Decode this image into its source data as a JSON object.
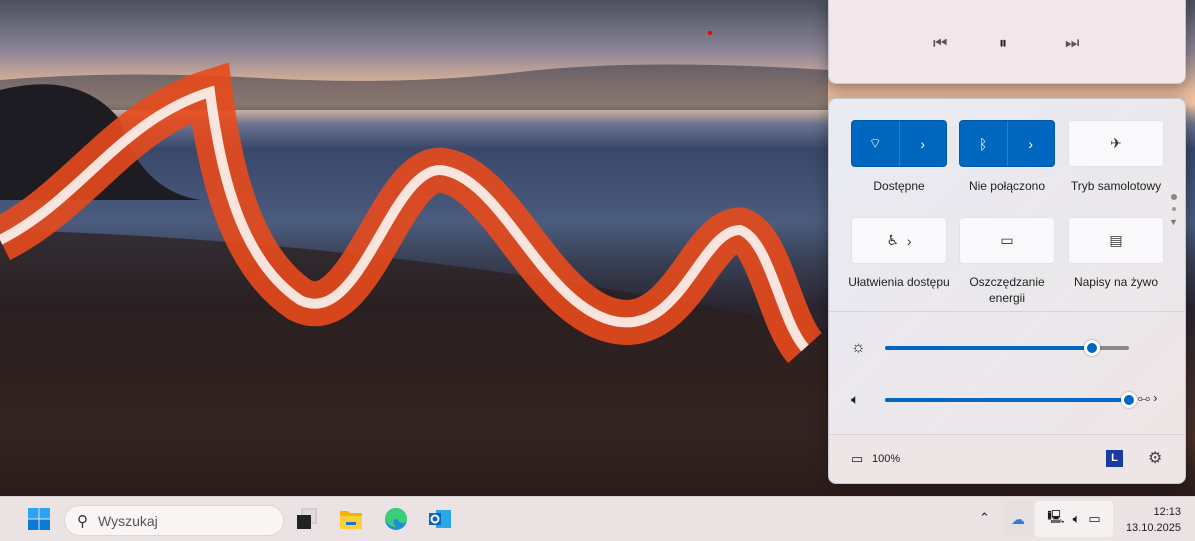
{
  "media": {
    "prev_icon": "previous-track-icon",
    "play_pause_icon": "pause-icon",
    "next_icon": "next-track-icon"
  },
  "quick_settings": {
    "tiles": [
      {
        "label": "Dostępne",
        "icon": "wifi-icon",
        "active": true
      },
      {
        "label": "Nie połączono",
        "icon": "bluetooth-icon",
        "active": true
      },
      {
        "label": "Tryb samolotowy",
        "icon": "airplane-icon",
        "active": false
      },
      {
        "label": "Ułatwienia dostępu",
        "icon": "accessibility-icon",
        "active": false
      },
      {
        "label": "Oszczędzanie energii",
        "icon": "battery-saver-icon",
        "active": false
      },
      {
        "label": "Napisy na żywo",
        "icon": "live-captions-icon",
        "active": false
      }
    ],
    "brightness_percent": 85,
    "volume_percent": 100,
    "battery": "100%",
    "user_initial": "L"
  },
  "taskbar": {
    "search_placeholder": "Wyszukaj",
    "time": "12:13",
    "date": "13.10.2025"
  },
  "colors": {
    "accent": "#0067c0"
  }
}
